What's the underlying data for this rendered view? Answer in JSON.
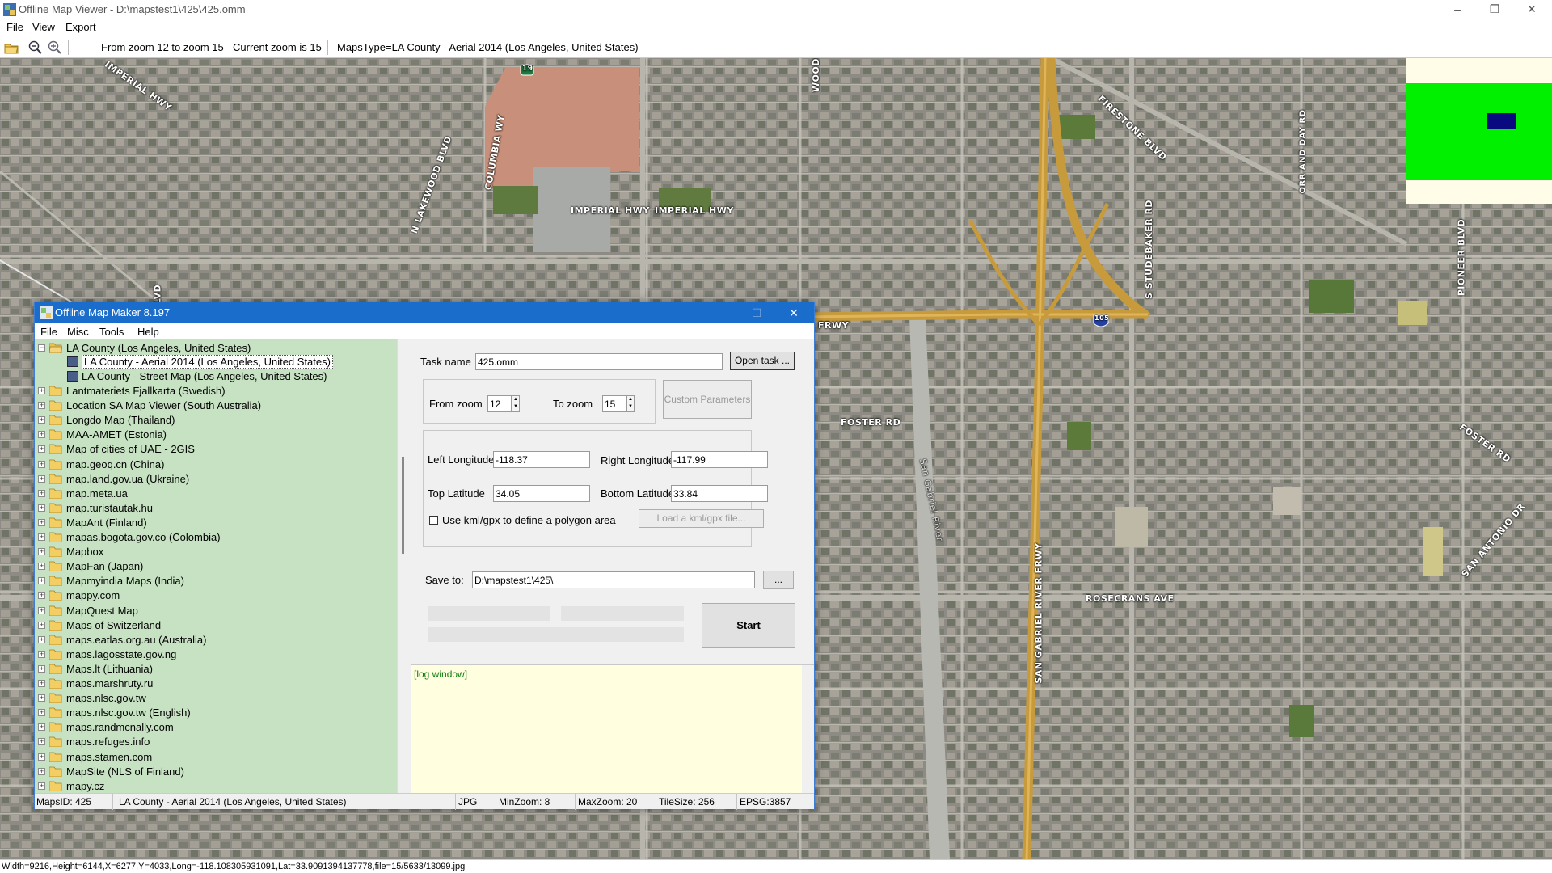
{
  "window": {
    "title": "Offline Map Viewer - D:\\mapstest1\\425\\425.omm",
    "menu": [
      "File",
      "View",
      "Export"
    ],
    "toolbar": {
      "zoom_range": "From zoom 12 to zoom 15",
      "current_zoom": "Current zoom is 15",
      "maps_type": "MapsType=LA County - Aerial 2014 (Los Angeles, United States)"
    },
    "status": "Width=9216,Height=6144,X=6277,Y=4033,Long=-118.108305931091,Lat=33.9091394137778,file=15/5633/13099.jpg"
  },
  "map": {
    "labels": [
      "IMPERIAL HWY",
      "IMPERIAL HWY",
      "IMPERIAL HWY",
      "N LAKEWOOD BLVD",
      "COLUMBIA WY",
      "WOODR",
      "FIRESTONE BLVD",
      "ORR AND DAY RD",
      "S STUDEBAKER RD",
      "PIONEER BLVD",
      "FRWY",
      "FOSTER RD",
      "FOSTER RD",
      "San Gabriel River",
      "SAN GABRIEL RIVER FRWY",
      "ROSECRANS AVE",
      "SAN ANTONIO DR",
      "BLVD"
    ],
    "shields": [
      "19",
      "105"
    ],
    "colors": {
      "minimap_bg": "#00f000",
      "minimap_view": "#0a0a80",
      "freeway": "#c89838"
    }
  },
  "dialog": {
    "title": "Offline Map Maker 8.197",
    "menu": [
      "File",
      "Misc",
      "Tools",
      "Help"
    ],
    "tree": {
      "expanded_root": "LA County (Los Angeles, United States)",
      "children": [
        "LA County - Aerial 2014 (Los Angeles, United States)",
        "LA County - Street Map (Los Angeles, United States)"
      ],
      "selected_child": 0,
      "folders": [
        "Lantmateriets Fjallkarta (Swedish)",
        "Location SA Map Viewer (South Australia)",
        "Longdo Map (Thailand)",
        "MAA-AMET (Estonia)",
        "Map of cities of UAE - 2GIS",
        "map.geoq.cn (China)",
        "map.land.gov.ua (Ukraine)",
        "map.meta.ua",
        "map.turistautak.hu",
        "MapAnt (Finland)",
        "mapas.bogota.gov.co (Colombia)",
        "Mapbox",
        "MapFan (Japan)",
        "Mapmyindia Maps (India)",
        "mappy.com",
        "MapQuest Map",
        "Maps of Switzerland",
        "maps.eatlas.org.au (Australia)",
        "maps.lagosstate.gov.ng",
        "Maps.lt (Lithuania)",
        "maps.marshruty.ru",
        "maps.nlsc.gov.tw",
        "maps.nlsc.gov.tw (English)",
        "maps.randmcnally.com",
        "maps.refuges.info",
        "maps.stamen.com",
        "MapSite (NLS of Finland)",
        "mapy.cz"
      ]
    },
    "form": {
      "task_label": "Task name",
      "task_value": "425.omm",
      "open_task": "Open task ...",
      "from_zoom_label": "From zoom",
      "from_zoom": "12",
      "to_zoom_label": "To zoom",
      "to_zoom": "15",
      "custom_params": "Custom Parameters",
      "left_lon_label": "Left Longitude",
      "left_lon": "-118.37",
      "right_lon_label": "Right Longitude",
      "right_lon": "-117.99",
      "top_lat_label": "Top Latitude",
      "top_lat": "34.05",
      "bottom_lat_label": "Bottom Latitude",
      "bottom_lat": "33.84",
      "kml_label": "Use kml/gpx to define a polygon area",
      "kml_button": "Load a kml/gpx file...",
      "save_label": "Save to:",
      "save_value": "D:\\mapstest1\\425\\",
      "browse": "...",
      "start": "Start"
    },
    "log_text": "[log window]",
    "status": {
      "maps_id": "MapsID: 425",
      "maps_name": "LA County - Aerial 2014 (Los Angeles, United States)",
      "format": "JPG",
      "min_zoom": "MinZoom: 8",
      "max_zoom": "MaxZoom: 20",
      "tile_size": "TileSize: 256",
      "epsg": "EPSG:3857"
    }
  }
}
